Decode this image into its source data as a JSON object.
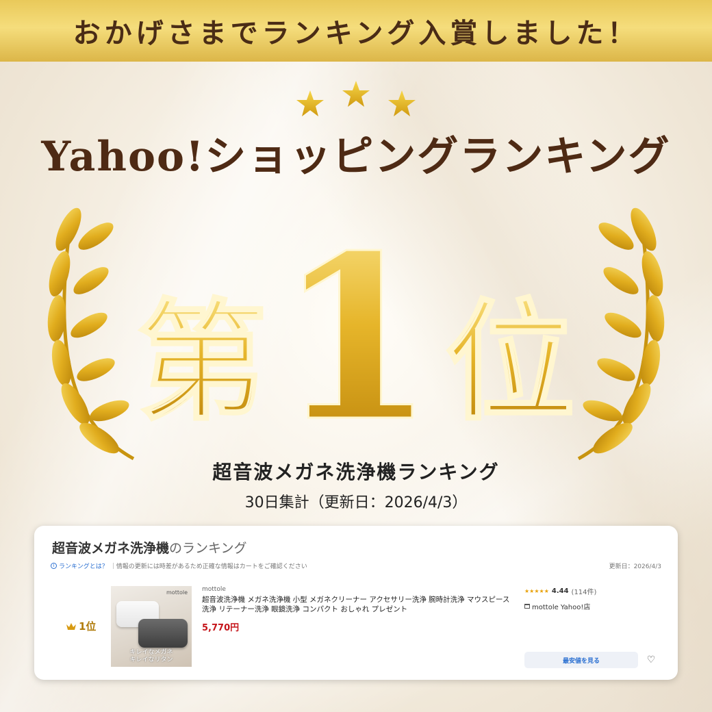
{
  "banner": {
    "text": "おかげさまでランキング入賞しました！"
  },
  "headline": "Yahoo!ショッピングランキング",
  "award": {
    "prefix": "第",
    "number": "1",
    "suffix": "位"
  },
  "ranking": {
    "title": "超音波メガネ洗浄機ランキング",
    "period": "30日集計（更新日：2026/4/3）"
  },
  "card": {
    "title_bold": "超音波メガネ洗浄機",
    "title_thin": "のランキング",
    "note_link": "ランキングとは？",
    "note_text": "｜情報の更新には時差があるため正確な情報はカートをご確認ください",
    "updated": "更新日：2026/4/3",
    "rank_label": "1位",
    "product": {
      "brand_on_image": "mottole",
      "image_caption_1": "キレイなメガネ",
      "image_caption_2": "キレイなリタン",
      "seller_small": "mottole",
      "title": "超音波洗浄機 メガネ洗浄機 小型 メガネクリーナー アクセサリー洗浄 腕時計洗浄 マウスピース洗浄 リテーナー洗浄 眼鏡洗浄 コンパクト おしゃれ プレゼント",
      "price": "5,770円",
      "rating_stars": "★★★★★",
      "rating_score": "4.44",
      "rating_count": "(114件)",
      "shop_name": "mottole Yahoo!店"
    },
    "lowest_button": "最安値を見る"
  },
  "icons": [
    "star-icon",
    "laurel-icon",
    "crown-icon",
    "info-icon",
    "store-icon",
    "heart-icon"
  ],
  "colors": {
    "gold": "#e2b62a",
    "brown": "#4e2a14",
    "price_red": "#c5141a",
    "link_blue": "#2a6fd1"
  }
}
